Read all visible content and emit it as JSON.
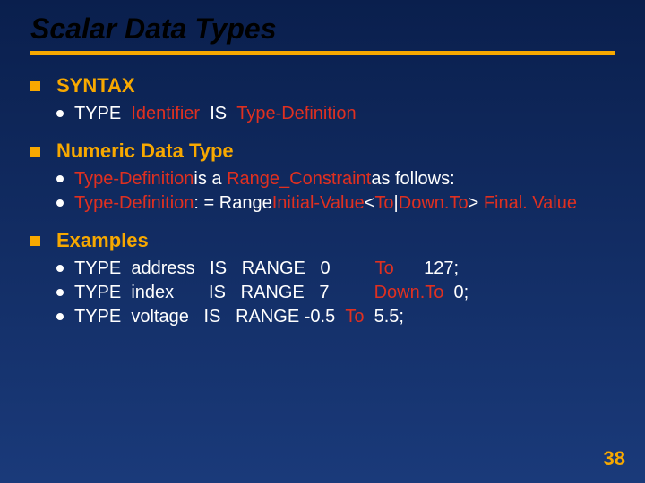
{
  "title": "Scalar Data Types",
  "page_number": "38",
  "sections": [
    {
      "label": "SYNTAX",
      "subs": [
        {
          "segments": [
            {
              "text": "TYPE  ",
              "red": false
            },
            {
              "text": "Identifier",
              "red": true
            },
            {
              "text": "  IS  ",
              "red": false
            },
            {
              "text": "Type-Definition",
              "red": true
            }
          ]
        }
      ]
    },
    {
      "label": "Numeric Data Type",
      "subs": [
        {
          "segments": [
            {
              "text": "Type-Definition",
              "red": true
            },
            {
              "text": " is a  ",
              "red": false
            },
            {
              "text": "Range_Constraint",
              "red": true
            },
            {
              "text": " as follows:",
              "red": false
            }
          ]
        },
        {
          "segments": [
            {
              "text": "Type-Definition",
              "red": true
            },
            {
              "text": " : = Range ",
              "red": false
            },
            {
              "text": "Initial-Value",
              "red": true
            },
            {
              "text": " < ",
              "red": false
            },
            {
              "text": "To",
              "red": true
            },
            {
              "text": " | ",
              "red": false
            },
            {
              "text": "Down.To",
              "red": true
            },
            {
              "text": ">  ",
              "red": false
            },
            {
              "text": "Final. Value",
              "red": true
            }
          ]
        }
      ]
    },
    {
      "label": "Examples",
      "subs": [
        {
          "segments": [
            {
              "text": "TYPE  address   IS   RANGE   0         ",
              "red": false
            },
            {
              "text": "To",
              "red": true
            },
            {
              "text": "      127;",
              "red": false
            }
          ]
        },
        {
          "segments": [
            {
              "text": "TYPE  index       IS   RANGE   7         ",
              "red": false
            },
            {
              "text": "Down.To",
              "red": true
            },
            {
              "text": "  0;",
              "red": false
            }
          ]
        },
        {
          "segments": [
            {
              "text": "TYPE  voltage   IS   RANGE -0.5  ",
              "red": false
            },
            {
              "text": "To",
              "red": true
            },
            {
              "text": "  5.5;",
              "red": false
            }
          ]
        }
      ]
    }
  ]
}
